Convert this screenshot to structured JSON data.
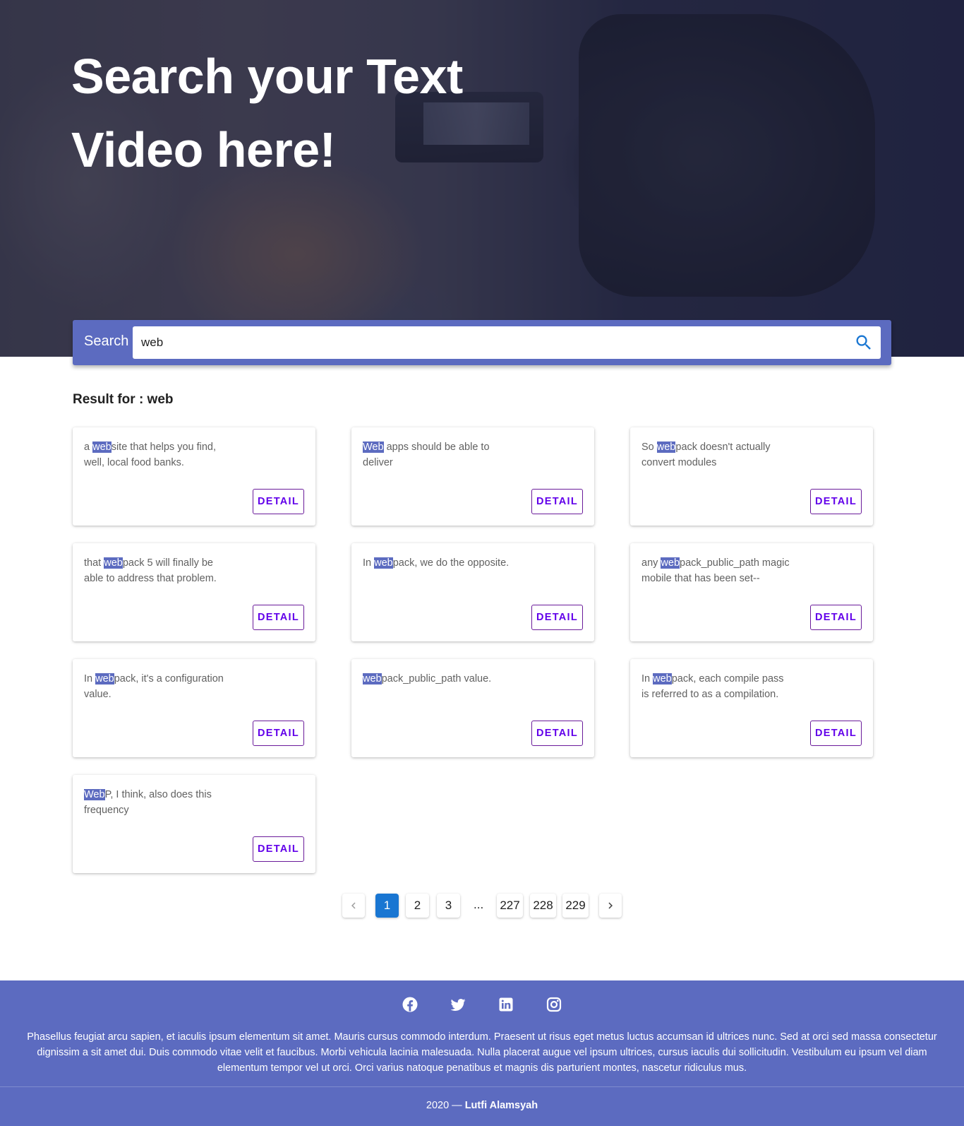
{
  "hero": {
    "title_line1": "Search your Text",
    "title_line2": "Video here!"
  },
  "search": {
    "label": "Search",
    "value": "web",
    "button_icon": "search-icon"
  },
  "results": {
    "heading": "Result for : web",
    "detail_label": "DETAIL",
    "items": [
      {
        "before": "a ",
        "match": "web",
        "after": "site that helps you find, well, local food banks."
      },
      {
        "before": "",
        "match": "Web",
        "after": " apps should be able to deliver"
      },
      {
        "before": "So ",
        "match": "web",
        "after": "pack doesn't actually convert modules"
      },
      {
        "before": "that ",
        "match": "web",
        "after": "pack 5 will finally be able to address that problem."
      },
      {
        "before": "In ",
        "match": "web",
        "after": "pack, we do the opposite."
      },
      {
        "before": "any ",
        "match": "web",
        "after": "pack_public_path magic mobile that has been set--"
      },
      {
        "before": "In ",
        "match": "web",
        "after": "pack, it's a configuration value."
      },
      {
        "before": "",
        "match": "web",
        "after": "pack_public_path value."
      },
      {
        "before": "In ",
        "match": "web",
        "after": "pack, each compile pass is referred to as a compilation."
      },
      {
        "before": "",
        "match": "Web",
        "after": "P, I think, also does this frequency"
      }
    ]
  },
  "pagination": {
    "prev_icon": "chevron-left-icon",
    "next_icon": "chevron-right-icon",
    "pages": [
      "1",
      "2",
      "3",
      "227",
      "228",
      "229"
    ],
    "ellipsis": "...",
    "current": "1"
  },
  "footer": {
    "social_icons": [
      "facebook-icon",
      "twitter-icon",
      "linkedin-icon",
      "instagram-icon"
    ],
    "text": "Phasellus feugiat arcu sapien, et iaculis ipsum elementum sit amet. Mauris cursus commodo interdum. Praesent ut risus eget metus luctus accumsan id ultrices nunc. Sed at orci sed massa consectetur dignissim a sit amet dui. Duis commodo vitae velit et faucibus. Morbi vehicula lacinia malesuada. Nulla placerat augue vel ipsum ultrices, cursus iaculis dui sollicitudin. Vestibulum eu ipsum vel diam elementum tempor vel ut orci. Orci varius natoque penatibus et magnis dis parturient montes, nascetur ridiculus mus.",
    "copyright_year": "2020 — ",
    "copyright_name": "Lutfi Alamsyah"
  },
  "colors": {
    "primary": "#5c6bc0",
    "active_page": "#1976d2",
    "detail_button": "#6200ea"
  }
}
